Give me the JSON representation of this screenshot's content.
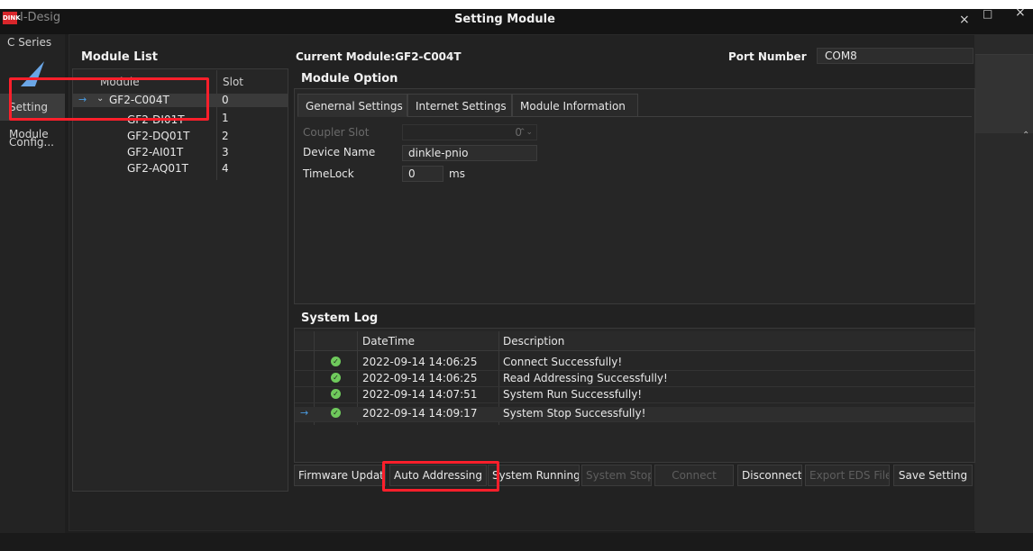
{
  "app": {
    "title": "I-Desig",
    "logo_text": "DINK",
    "series": "C Series",
    "side_items": [
      "Setting Module",
      "Config..."
    ]
  },
  "dialog": {
    "title": "Setting Module",
    "close": "×"
  },
  "window_controls": {
    "maximize": "□",
    "close": "×"
  },
  "module_list": {
    "heading": "Module List",
    "columns": {
      "module": "Module",
      "slot": "Slot"
    },
    "rows": [
      {
        "name": "GF2-C004T",
        "slot": "0"
      },
      {
        "name": "GF2-DI01T",
        "slot": "1"
      },
      {
        "name": "GF2-DQ01T",
        "slot": "2"
      },
      {
        "name": "GF2-AI01T",
        "slot": "3"
      },
      {
        "name": "GF2-AQ01T",
        "slot": "4"
      }
    ]
  },
  "header": {
    "current_module": "Current Module:GF2-C004T",
    "port_label": "Port Number",
    "port_value": "COM8"
  },
  "module_option": {
    "heading": "Module Option",
    "tabs": [
      "Genernal Settings",
      "Internet Settings",
      "Module Information"
    ],
    "coupler_slot_label": "Coupler Slot",
    "coupler_slot_value": "0",
    "device_name_label": "Device Name",
    "device_name_value": "dinkle-pnio",
    "timelock_label": "TimeLock",
    "timelock_value": "0",
    "timelock_unit": "ms"
  },
  "system_log": {
    "heading": "System Log",
    "columns": {
      "datetime": "DateTime",
      "description": "Description"
    },
    "rows": [
      {
        "datetime": "2022-09-14 14:06:25",
        "description": "Connect Successfully!"
      },
      {
        "datetime": "2022-09-14 14:06:25",
        "description": "Read Addressing Successfully!"
      },
      {
        "datetime": "2022-09-14 14:07:51",
        "description": "System Run Successfully!"
      },
      {
        "datetime": "2022-09-14 14:09:17",
        "description": "System Stop Successfully!"
      }
    ]
  },
  "buttons": {
    "firmware_update": "Firmware Update",
    "auto_addressing": "Auto Addressing",
    "system_running": "System Running",
    "system_stop": "System Stop",
    "connect": "Connect",
    "disconnect": "Disconnect",
    "export_eds": "Export EDS File",
    "save_setting": "Save Setting"
  },
  "colors": {
    "highlight": "#ff1f2b",
    "accent": "#4a9be0",
    "success": "#6fca5c"
  }
}
